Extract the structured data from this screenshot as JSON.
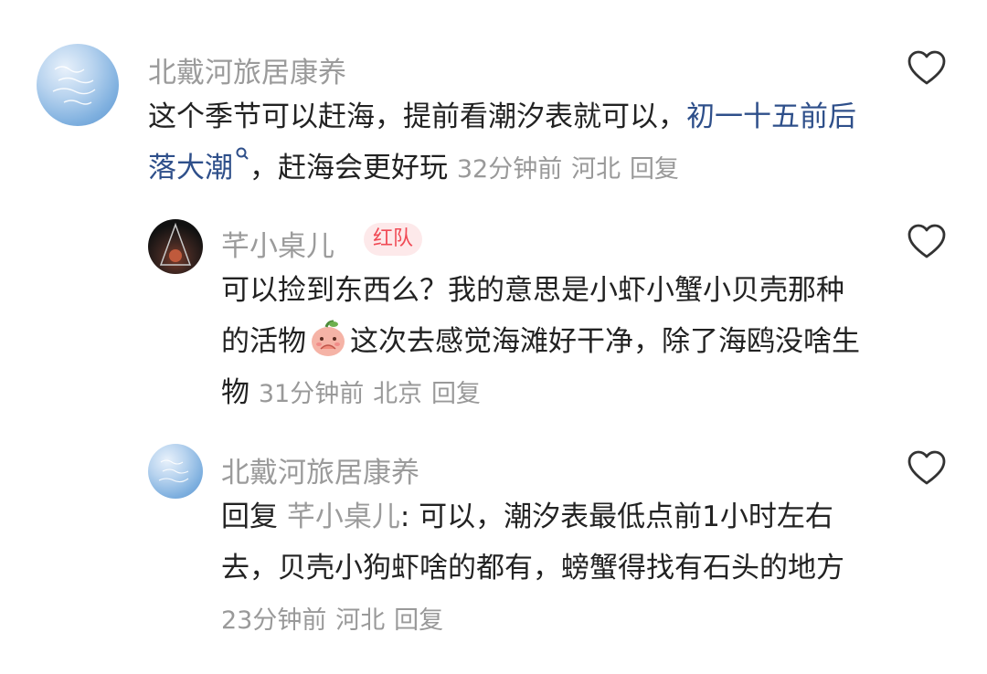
{
  "comments": [
    {
      "author": "北戴河旅居康养",
      "text_before_link": "这个季节可以赶海，提前看潮汐表就可以，",
      "link": "初一十五前后落大潮",
      "text_after_link": "，赶海会更好玩",
      "time": "32分钟前",
      "location": "河北",
      "reply_label": "回复"
    },
    {
      "author": "芊小桌儿",
      "badge": "红队",
      "text_before_emoji": "可以捡到东西么？我的意思是小虾小蟹小贝壳那种的活物",
      "text_after_emoji": "这次去感觉海滩好干净，除了海鸥没啥生物",
      "time": "31分钟前",
      "location": "北京",
      "reply_label": "回复"
    },
    {
      "author": "北戴河旅居康养",
      "reply_prefix": "回复 ",
      "mention": "芊小桌儿",
      "mention_sep": ": ",
      "text": "可以，潮汐表最低点前1小时左右去，贝壳小狗虾啥的都有，螃蟹得找有石头的地方",
      "time": "23分钟前",
      "location": "河北",
      "reply_label": "回复"
    }
  ],
  "icons": {
    "like": "heart-outline-icon",
    "search_link": "magnifier-icon",
    "emoji": "praying-peach-emoji-icon"
  },
  "colors": {
    "author": "#9b9b9b",
    "link": "#2e4f8a",
    "badge_bg": "#fde9ea",
    "badge_text": "#f04a55"
  }
}
